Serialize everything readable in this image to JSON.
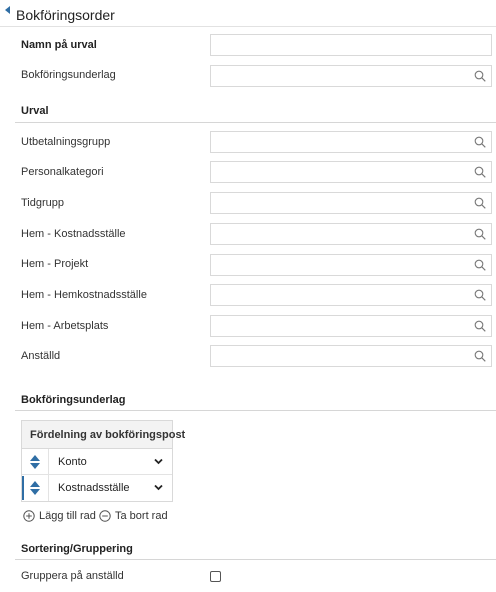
{
  "header": {
    "title": "Bokföringsorder"
  },
  "form": {
    "name_label": "Namn på urval",
    "name_value": "",
    "basis_label": "Bokföringsunderlag",
    "basis_value": ""
  },
  "selection": {
    "heading": "Urval",
    "fields": [
      {
        "label": "Utbetalningsgrupp",
        "value": ""
      },
      {
        "label": "Personalkategori",
        "value": ""
      },
      {
        "label": "Tidgrupp",
        "value": ""
      },
      {
        "label": "Hem - Kostnadsställe",
        "value": ""
      },
      {
        "label": "Hem - Projekt",
        "value": ""
      },
      {
        "label": "Hem - Hemkostnadsställe",
        "value": ""
      },
      {
        "label": "Hem - Arbetsplats",
        "value": ""
      },
      {
        "label": "Anställd",
        "value": ""
      }
    ]
  },
  "basis": {
    "heading": "Bokföringsunderlag",
    "grid_header": "Fördelning av bokföringspost",
    "rows": [
      {
        "value": "Konto"
      },
      {
        "value": "Kostnadsställe"
      }
    ],
    "add_row": "Lägg till rad",
    "remove_row": "Ta bort rad"
  },
  "sorting": {
    "heading": "Sortering/Gruppering",
    "group_label": "Gruppera på anställd",
    "group_checked": false
  },
  "icons": {
    "back": "caret-left-icon",
    "search": "search-icon",
    "reorder": "up-down-arrows-icon",
    "dropdown": "chevron-down-icon",
    "add": "plus-circle-icon",
    "remove": "minus-circle-icon"
  },
  "colors": {
    "accent": "#2f6ea5",
    "border": "#d9d9d9"
  }
}
